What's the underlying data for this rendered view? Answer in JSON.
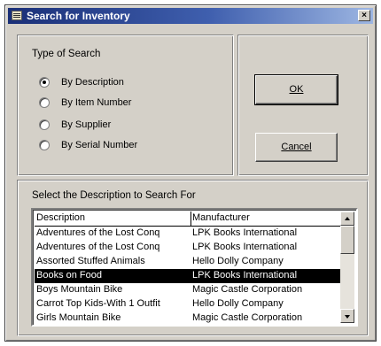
{
  "window": {
    "title": "Search for Inventory",
    "close_glyph": "×"
  },
  "search_type": {
    "label": "Type of Search",
    "options": [
      {
        "label": "By Description",
        "checked": true
      },
      {
        "label": "By Item Number",
        "checked": false
      },
      {
        "label": "By Supplier",
        "checked": false
      },
      {
        "label": "By Serial Number",
        "checked": false
      }
    ]
  },
  "buttons": {
    "ok_label": "OK",
    "cancel_label": "Cancel"
  },
  "list": {
    "label": "Select the Description to Search For",
    "columns": {
      "description": "Description",
      "manufacturer": "Manufacturer"
    },
    "rows": [
      {
        "description": "Adventures of the Lost Conq",
        "manufacturer": "LPK Books International"
      },
      {
        "description": "Adventures of the Lost Conq",
        "manufacturer": "LPK Books International"
      },
      {
        "description": "Assorted Stuffed Animals",
        "manufacturer": "Hello Dolly Company"
      },
      {
        "description": "Books on Food",
        "manufacturer": "LPK Books International"
      },
      {
        "description": "Boys Mountain Bike",
        "manufacturer": "Magic Castle Corporation"
      },
      {
        "description": "Carrot Top Kids-With 1 Outfit",
        "manufacturer": "Hello Dolly Company"
      },
      {
        "description": "Girls Mountain Bike",
        "manufacturer": "Magic Castle Corporation"
      }
    ],
    "selected_index": 3
  },
  "colors": {
    "title_start": "#1a2f77",
    "face": "#d4d0c8",
    "selection": "#000000"
  }
}
